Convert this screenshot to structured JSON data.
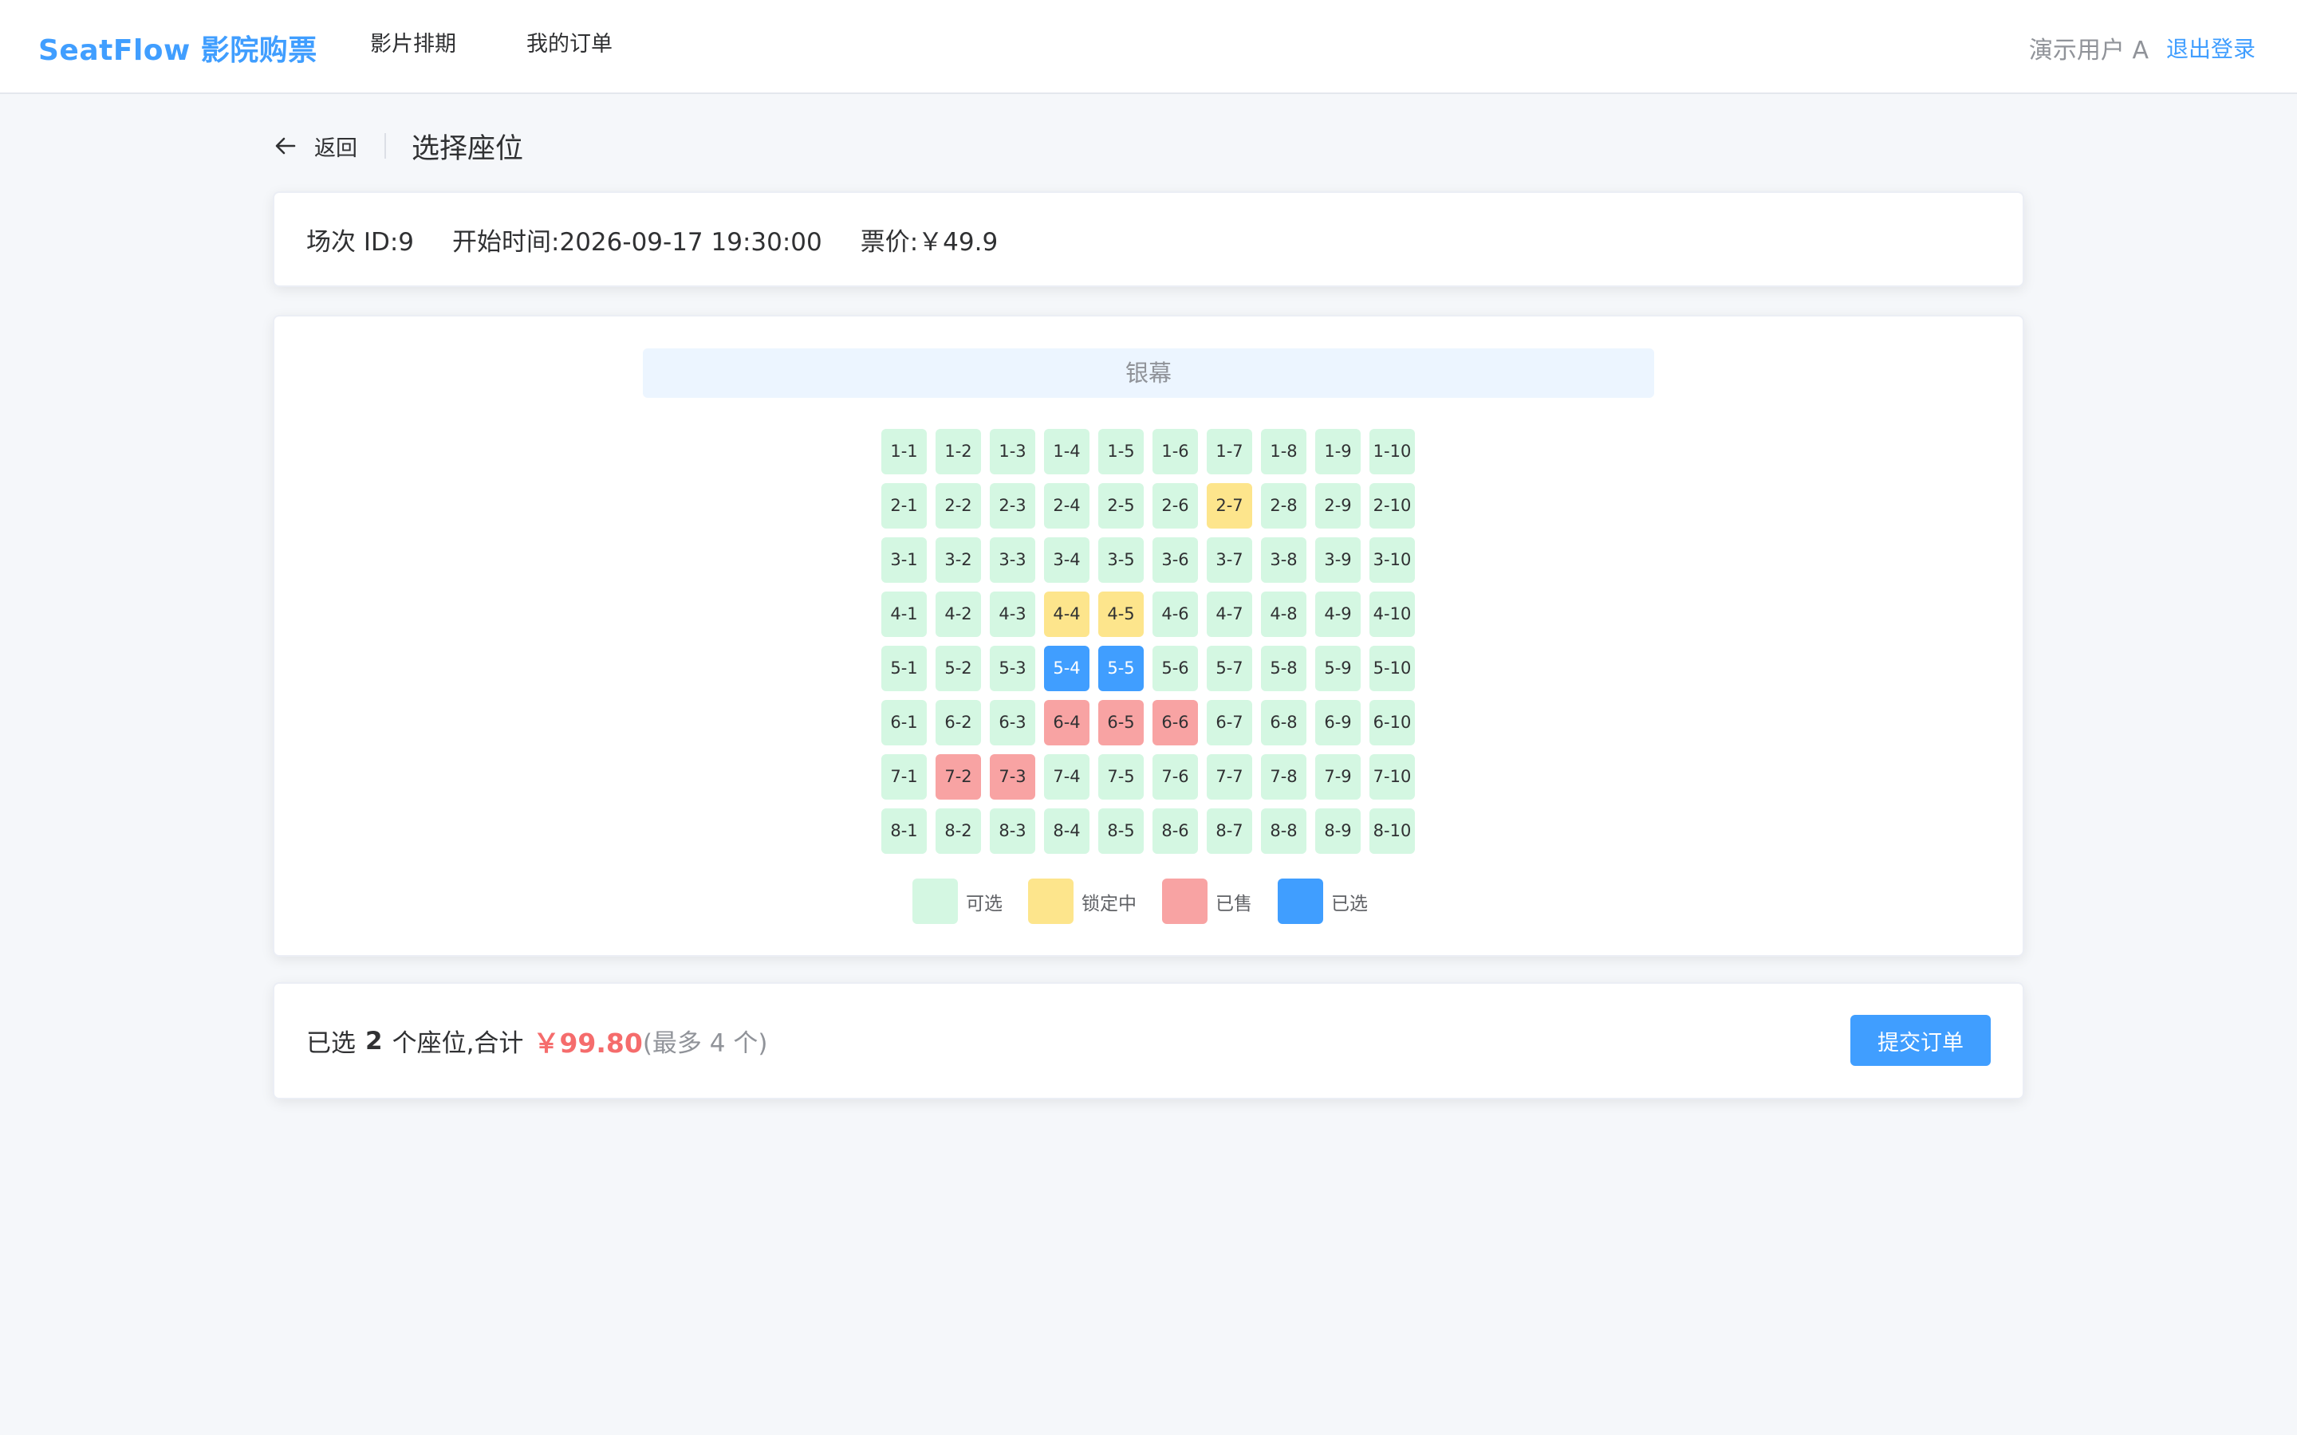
{
  "header": {
    "brand": "SeatFlow 影院购票",
    "nav": [
      "影片排期",
      "我的订单"
    ],
    "user_name": "演示用户 A",
    "logout_label": "退出登录"
  },
  "page": {
    "back_label": "返回",
    "title": "选择座位"
  },
  "session_info": {
    "session_id": "场次 ID:9",
    "start_time": "开始时间:2026-09-17 19:30:00",
    "price": "票价:￥49.9"
  },
  "seat_map": {
    "screen_label": "银幕",
    "rows": 8,
    "cols": 10,
    "locked": [
      "2-7",
      "4-4",
      "4-5"
    ],
    "sold": [
      "6-4",
      "6-5",
      "6-6",
      "7-2",
      "7-3"
    ],
    "selected": [
      "5-4",
      "5-5"
    ]
  },
  "legend": [
    {
      "label": "可选",
      "status": "available",
      "color": "#d4f7e2"
    },
    {
      "label": "锁定中",
      "status": "locked",
      "color": "#fde58c"
    },
    {
      "label": "已售",
      "status": "sold",
      "color": "#f8a3a3"
    },
    {
      "label": "已选",
      "status": "selected",
      "color": "#409eff"
    }
  ],
  "summary": {
    "prefix": "已选",
    "count": "2",
    "middle": "个座位,合计",
    "total": "￥99.80",
    "limit": "(最多 4 个)",
    "submit_label": "提交订单"
  }
}
